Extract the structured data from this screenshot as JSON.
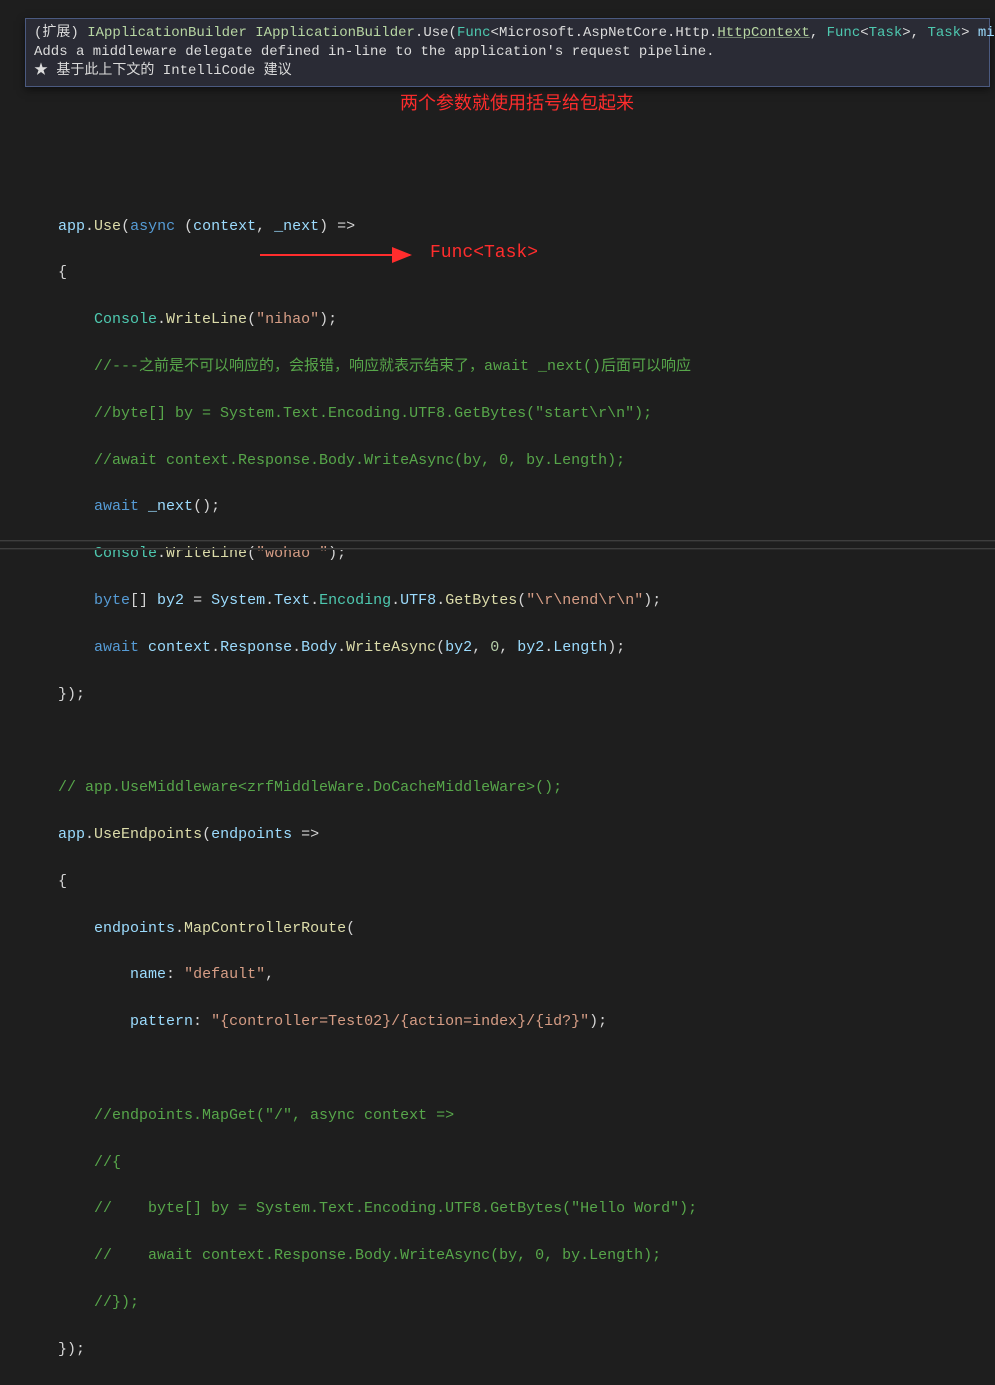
{
  "tooltip": {
    "prefix": "(扩展) ",
    "ret": "IApplicationBuilder",
    "owner": "IApplicationBuilder",
    "methodName": "Use",
    "lparen": "(",
    "func": "Func",
    "lt": "<",
    "ns": "Microsoft.AspNetCore.Http.",
    "httpctx": "HttpContext",
    "comma1": ", ",
    "func2": "Func",
    "lt2": "<",
    "task": "Task",
    "gt2": ">",
    "comma2": ", ",
    "task2": "Task",
    "gt": ">",
    "paramname": " middleware",
    "rparen": ")",
    "desc": "Adds a middleware delegate defined in-line to the application's request pipeline.",
    "intellicode": "★  基于此上下文的 IntelliCode 建议"
  },
  "annot": {
    "top": "两个参数就使用括号给包起来",
    "mid": "Func<Task>"
  },
  "code": {
    "l1a": "app",
    "l1b": ".",
    "l1c": "Use",
    "l1d": "(",
    "l1e": "async",
    "l1f": " (",
    "l1g": "context",
    "l1h": ", ",
    "l1i": "_next",
    "l1j": ") =>",
    "l2": "{",
    "l3a": "Console",
    "l3b": ".",
    "l3c": "WriteLine",
    "l3d": "(",
    "l3e": "\"nihao\"",
    "l3f": ");",
    "l4": "//---之前是不可以响应的，会报错，响应就表示结束了，await _next()后面可以响应",
    "l5": "//byte[] by = System.Text.Encoding.UTF8.GetBytes(\"start\\r\\n\");",
    "l6": "//await context.Response.Body.WriteAsync(by, 0, by.Length);",
    "l7a": "await",
    "l7b": " ",
    "l7c": "_next",
    "l7d": "();",
    "l8a": "Console",
    "l8b": ".",
    "l8c": "WriteLine",
    "l8d": "(",
    "l8e": "\"wohao \"",
    "l8f": ");",
    "l9a": "byte",
    "l9b": "[] ",
    "l9c": "by2",
    "l9d": " = ",
    "l9e": "System",
    "l9f": ".",
    "l9g": "Text",
    "l9h": ".",
    "l9i": "Encoding",
    "l9j": ".",
    "l9k": "UTF8",
    "l9l": ".",
    "l9m": "GetBytes",
    "l9n": "(",
    "l9o": "\"\\r\\nend\\r\\n\"",
    "l9p": ");",
    "l10a": "await",
    "l10b": " ",
    "l10c": "context",
    "l10d": ".",
    "l10e": "Response",
    "l10f": ".",
    "l10g": "Body",
    "l10h": ".",
    "l10i": "WriteAsync",
    "l10j": "(",
    "l10k": "by2",
    "l10l": ", ",
    "l10m": "0",
    "l10n": ", ",
    "l10o": "by2",
    "l10p": ".",
    "l10q": "Length",
    "l10r": ");",
    "l11": "});",
    "l13": "// app.UseMiddleware<zrfMiddleWare.DoCacheMiddleWare>();",
    "l14a": "app",
    "l14b": ".",
    "l14c": "UseEndpoints",
    "l14d": "(",
    "l14e": "endpoints",
    "l14f": " =>",
    "l15": "{",
    "l16a": "endpoints",
    "l16b": ".",
    "l16c": "MapControllerRoute",
    "l16d": "(",
    "l17a": "name",
    "l17b": ": ",
    "l17c": "\"default\"",
    "l17d": ",",
    "l18a": "pattern",
    "l18b": ": ",
    "l18c": "\"{controller=Test02}/{action=index}/{id?}\"",
    "l18d": ");",
    "l20": "//endpoints.MapGet(\"/\", async context =>",
    "l21": "//{",
    "l22": "//    byte[] by = System.Text.Encoding.UTF8.GetBytes(\"Hello Word\");",
    "l23": "//    await context.Response.Body.WriteAsync(by, 0, by.Length);",
    "l24": "//});",
    "l25": "});"
  }
}
